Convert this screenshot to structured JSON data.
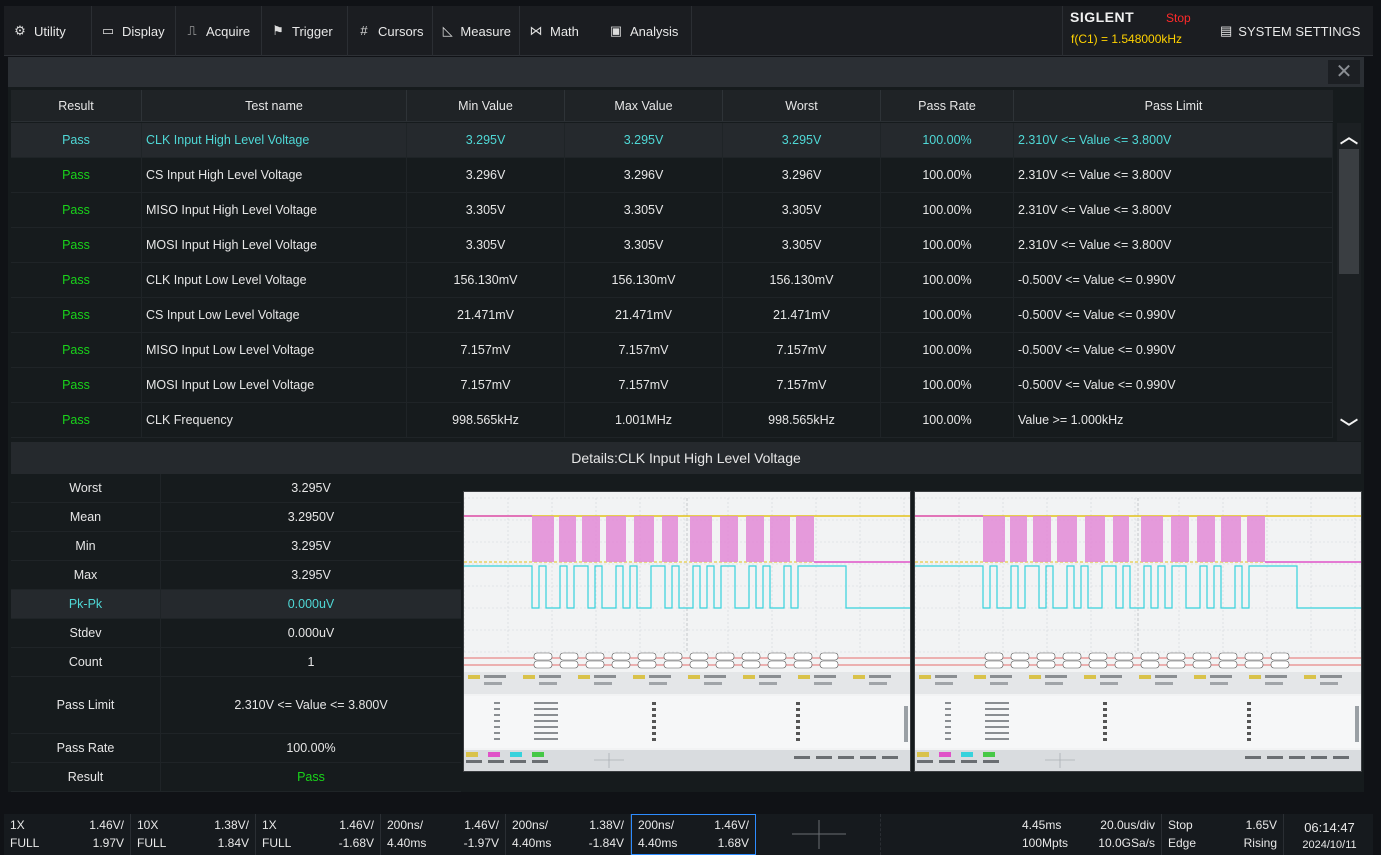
{
  "menu": {
    "items": [
      {
        "label": "Utility",
        "icon": "gear-icon"
      },
      {
        "label": "Display",
        "icon": "monitor-icon"
      },
      {
        "label": "Acquire",
        "icon": "acquire-icon"
      },
      {
        "label": "Trigger",
        "icon": "flag-icon"
      },
      {
        "label": "Cursors",
        "icon": "cursors-icon"
      },
      {
        "label": "Measure",
        "icon": "ruler-icon"
      },
      {
        "label": "Math",
        "icon": "math-icon"
      },
      {
        "label": "Analysis",
        "icon": "analysis-icon"
      }
    ],
    "brand": "SIGLENT",
    "run_state": "Stop",
    "freq_readout": "f(C1) = 1.548000kHz",
    "system_settings": "SYSTEM SETTINGS"
  },
  "table": {
    "columns": [
      "Result",
      "Test name",
      "Min Value",
      "Max Value",
      "Worst",
      "Pass Rate",
      "Pass Limit"
    ],
    "rows": [
      {
        "result": "Pass",
        "name": "CLK Input High Level Voltage",
        "min": "3.295V",
        "max": "3.295V",
        "worst": "3.295V",
        "rate": "100.00%",
        "limit": "2.310V <= Value <= 3.800V"
      },
      {
        "result": "Pass",
        "name": "CS Input High Level Voltage",
        "min": "3.296V",
        "max": "3.296V",
        "worst": "3.296V",
        "rate": "100.00%",
        "limit": "2.310V <= Value <= 3.800V"
      },
      {
        "result": "Pass",
        "name": "MISO Input High Level Voltage",
        "min": "3.305V",
        "max": "3.305V",
        "worst": "3.305V",
        "rate": "100.00%",
        "limit": "2.310V <= Value <= 3.800V"
      },
      {
        "result": "Pass",
        "name": "MOSI Input High Level Voltage",
        "min": "3.305V",
        "max": "3.305V",
        "worst": "3.305V",
        "rate": "100.00%",
        "limit": "2.310V <= Value <= 3.800V"
      },
      {
        "result": "Pass",
        "name": "CLK Input Low Level Voltage",
        "min": "156.130mV",
        "max": "156.130mV",
        "worst": "156.130mV",
        "rate": "100.00%",
        "limit": "-0.500V <= Value <= 0.990V"
      },
      {
        "result": "Pass",
        "name": "CS Input Low Level Voltage",
        "min": "21.471mV",
        "max": "21.471mV",
        "worst": "21.471mV",
        "rate": "100.00%",
        "limit": "-0.500V <= Value <= 0.990V"
      },
      {
        "result": "Pass",
        "name": "MISO Input Low Level Voltage",
        "min": "7.157mV",
        "max": "7.157mV",
        "worst": "7.157mV",
        "rate": "100.00%",
        "limit": "-0.500V <= Value <= 0.990V"
      },
      {
        "result": "Pass",
        "name": "MOSI Input Low Level Voltage",
        "min": "7.157mV",
        "max": "7.157mV",
        "worst": "7.157mV",
        "rate": "100.00%",
        "limit": "-0.500V <= Value <= 0.990V"
      },
      {
        "result": "Pass",
        "name": "CLK Frequency",
        "min": "998.565kHz",
        "max": "1.001MHz",
        "worst": "998.565kHz",
        "rate": "100.00%",
        "limit": "Value >= 1.000kHz"
      }
    ]
  },
  "details": {
    "title": "Details:CLK Input High Level Voltage",
    "stats": [
      {
        "label": "Worst",
        "value": "3.295V"
      },
      {
        "label": "Mean",
        "value": "3.2950V"
      },
      {
        "label": "Min",
        "value": "3.295V"
      },
      {
        "label": "Max",
        "value": "3.295V"
      },
      {
        "label": "Pk-Pk",
        "value": "0.000uV"
      },
      {
        "label": "Stdev",
        "value": "0.000uV"
      },
      {
        "label": "Count",
        "value": "1"
      },
      {
        "label": "Pass Limit",
        "value": "2.310V <= Value <= 3.800V"
      },
      {
        "label": "Pass Rate",
        "value": "100.00%"
      },
      {
        "label": "Result",
        "value": "Pass"
      }
    ]
  },
  "status": {
    "ch1": {
      "a": "1X",
      "b": "1.46V/",
      "c": "FULL",
      "d": "1.97V"
    },
    "ch2": {
      "a": "10X",
      "b": "1.38V/",
      "c": "FULL",
      "d": "1.84V"
    },
    "ch3": {
      "a": "1X",
      "b": "1.46V/",
      "c": "FULL",
      "d": "-1.68V"
    },
    "ch4": {
      "a": "200ns/",
      "b": "1.46V/",
      "c": "4.40ms",
      "d": "-1.97V"
    },
    "ch5": {
      "a": "200ns/",
      "b": "1.38V/",
      "c": "4.40ms",
      "d": "-1.84V"
    },
    "ch6": {
      "a": "200ns/",
      "b": "1.46V/",
      "c": "4.40ms",
      "d": "1.68V"
    },
    "timebase": {
      "delay": "4.45ms",
      "scale": "20.0us/div",
      "points": "100Mpts",
      "rate": "10.0GSa/s"
    },
    "trigger": {
      "state": "Stop",
      "level": "1.65V",
      "type": "Edge",
      "slope": "Rising"
    },
    "clock": {
      "time": "06:14:47",
      "date": "2024/10/11"
    }
  },
  "colors": {
    "pass": "#19d41a",
    "selected": "#4fd8d6",
    "brand_freq": "#ffd200",
    "stop": "#ff2a2a"
  }
}
